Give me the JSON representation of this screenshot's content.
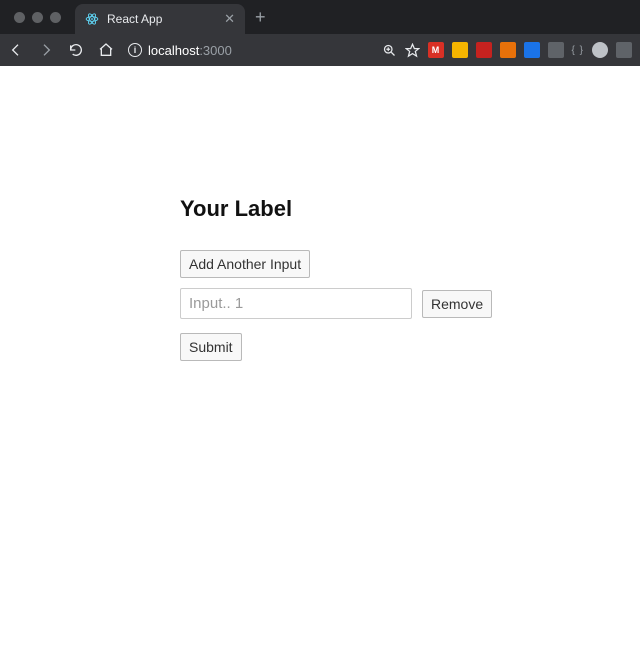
{
  "browser": {
    "tab_title": "React App",
    "url_host": "localhost",
    "url_port": ":3000"
  },
  "page": {
    "heading": "Your Label",
    "add_button": "Add Another Input",
    "inputs": [
      {
        "placeholder": "Input.. 1",
        "value": ""
      }
    ],
    "remove_button": "Remove",
    "submit_button": "Submit"
  }
}
